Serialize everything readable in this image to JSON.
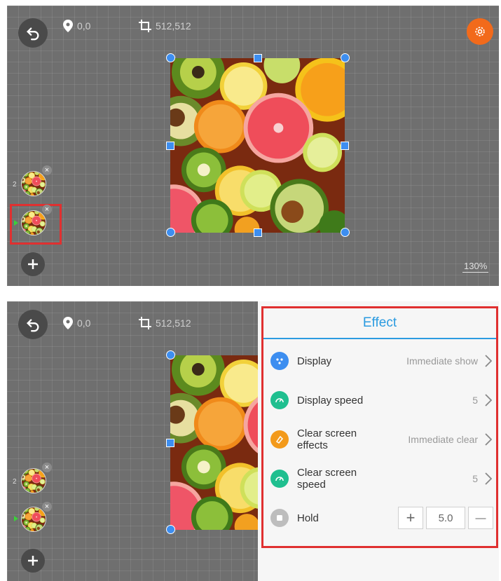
{
  "toolbar": {
    "position_value": "0,0",
    "size_value": "512,512"
  },
  "zoom_label": "130%",
  "programs": [
    {
      "number": "2"
    },
    {
      "number": ""
    }
  ],
  "close_symbol": "×",
  "effect_panel": {
    "title": "Effect",
    "rows": [
      {
        "label": "Display",
        "value": "Immediate show",
        "icon": "dots-icon",
        "color": "#3d8ef0"
      },
      {
        "label": "Display speed",
        "value": "5",
        "icon": "speedometer-icon",
        "color": "#1fbf8f"
      },
      {
        "label": "Clear screen effects",
        "value": "Immediate clear",
        "icon": "eraser-icon",
        "color": "#f39a1b"
      },
      {
        "label": "Clear screen speed",
        "value": "5",
        "icon": "speedometer-icon",
        "color": "#1fbf8f"
      }
    ],
    "hold": {
      "label": "Hold",
      "value": "5.0",
      "plus": "+",
      "minus": "—",
      "icon": "stop-icon",
      "color": "#bdbdbd"
    }
  },
  "colors": {
    "accent": "#2b9be0",
    "settings": "#f26a1b",
    "highlight": "#e03030",
    "handle": "#3d8ef0"
  }
}
